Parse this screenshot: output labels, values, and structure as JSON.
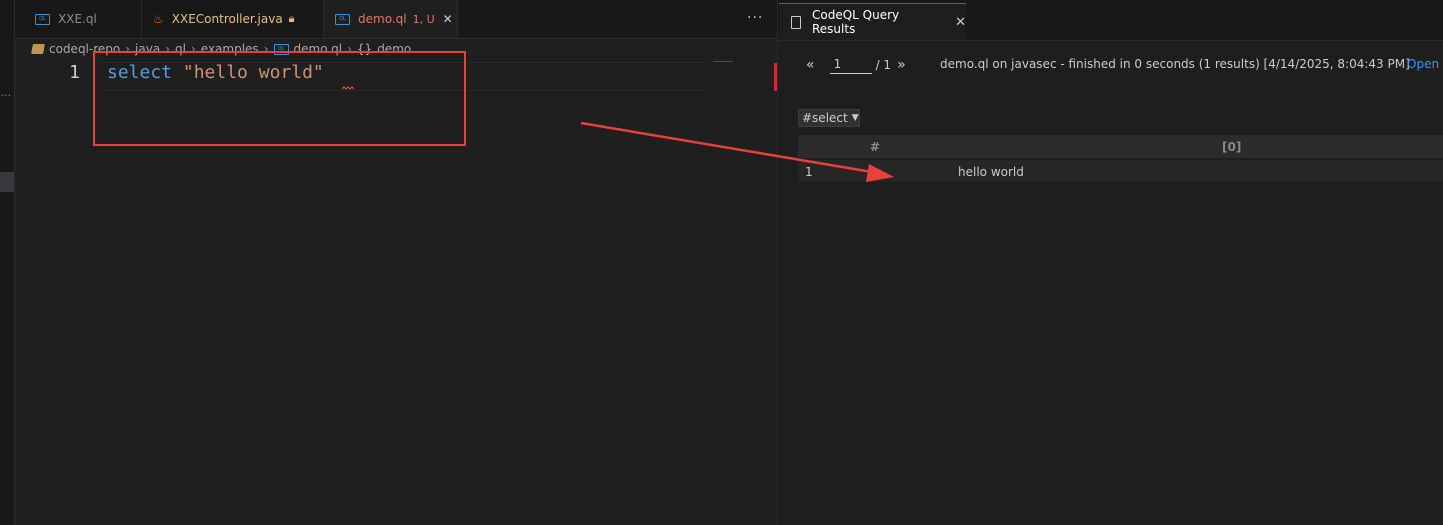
{
  "editor": {
    "tabs": [
      {
        "label": "XXE.ql",
        "status": ""
      },
      {
        "label": "XXEController.java",
        "status": ""
      },
      {
        "label": "demo.ql",
        "status": "1, U"
      }
    ],
    "more_label": "···",
    "breadcrumb": [
      "codeql-repo",
      "java",
      "ql",
      "examples",
      "demo.ql",
      "demo"
    ],
    "line_number": "1",
    "code_keyword": "select",
    "code_string": "\"hello world\""
  },
  "results": {
    "tab_label": "CodeQL Query Results",
    "close_label": "✕",
    "page_value": "1",
    "page_total": "/ 1",
    "prev_label": "«",
    "next_label": "»",
    "query_info": "demo.ql on javasec - finished in 0 seconds (1 results) [4/14/2025, 8:04:43 PM]",
    "open_label": "Open",
    "result_set": "#select",
    "columns": [
      "#",
      "[0]"
    ],
    "rows": [
      {
        "index": "1",
        "value": "hello world"
      }
    ]
  },
  "colors": {
    "annotation": "#e8403a",
    "keyword": "#569cd6",
    "string": "#ce9178",
    "link": "#3794ff"
  }
}
